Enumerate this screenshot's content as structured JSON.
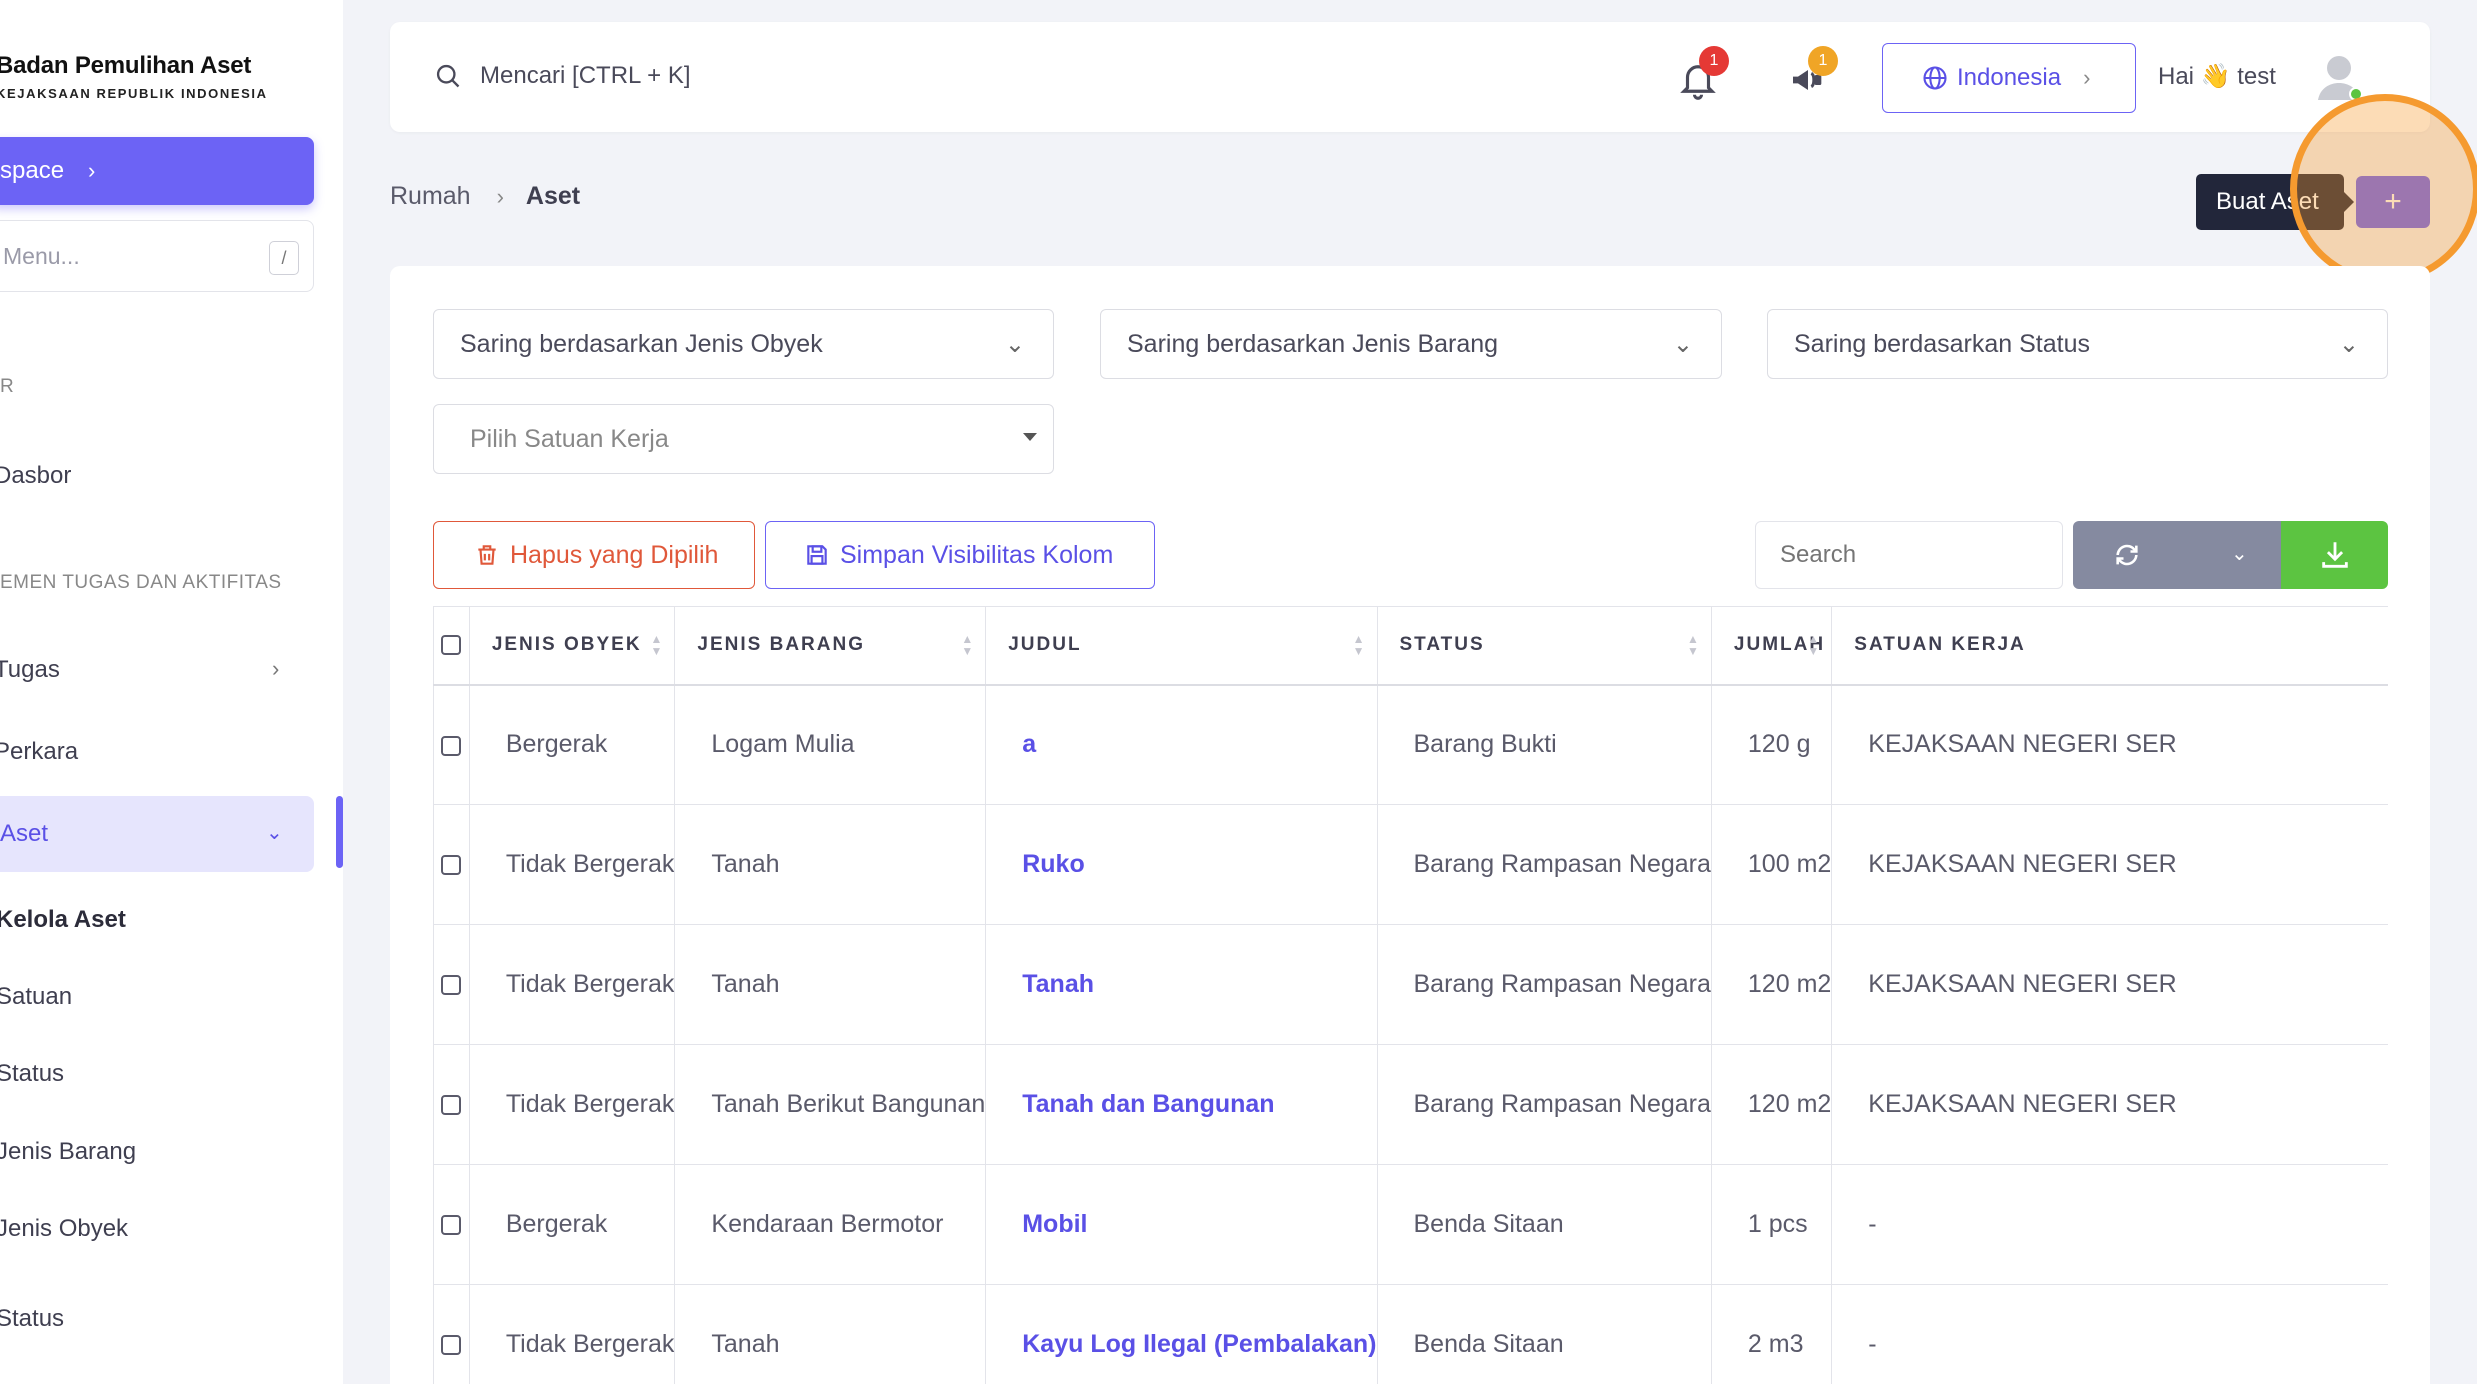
{
  "sidebar": {
    "brand_title": "Badan Pemulihan Aset",
    "brand_subtitle": "KEJAKSAAN REPUBLIK INDONESIA",
    "workspace_label": "space",
    "menu_search_placeholder": "Menu...",
    "menu_search_shortcut": "/",
    "section_1": "R",
    "dashboard": "Dasbor",
    "section_2": "EMEN TUGAS DAN AKTIFITAS",
    "tugas": "Tugas",
    "perkara": "Perkara",
    "aset": "Aset",
    "kelola_aset": "Kelola Aset",
    "satuan": "Satuan",
    "status": "Status",
    "jenis_barang": "Jenis Barang",
    "jenis_obyek": "Jenis Obyek",
    "status_2": "Status"
  },
  "topbar": {
    "search_placeholder": "Mencari [CTRL + K]",
    "notif_count": "1",
    "announce_count": "1",
    "language": "Indonesia",
    "greeting": "Hai 👋 test"
  },
  "breadcrumb": {
    "home": "Rumah",
    "current": "Aset"
  },
  "actions": {
    "tooltip": "Buat Aset",
    "add_symbol": "+"
  },
  "filters": {
    "jenis_obyek": "Saring berdasarkan Jenis Obyek",
    "jenis_barang": "Saring berdasarkan Jenis Barang",
    "status": "Saring berdasarkan Status",
    "satuan_kerja": "Pilih Satuan Kerja"
  },
  "toolbar": {
    "delete_selected": "Hapus yang Dipilih",
    "save_visibility": "Simpan Visibilitas Kolom",
    "search_placeholder": "Search"
  },
  "table": {
    "headers": [
      "JENIS OBYEK",
      "JENIS BARANG",
      "JUDUL",
      "STATUS",
      "JUMLAH",
      "SATUAN KERJA"
    ],
    "rows": [
      [
        "Bergerak",
        "Logam Mulia",
        "a",
        "Barang Bukti",
        "120 g",
        "KEJAKSAAN NEGERI SER"
      ],
      [
        "Tidak Bergerak",
        "Tanah",
        "Ruko",
        "Barang Rampasan Negara",
        "100 m2",
        "KEJAKSAAN NEGERI SER"
      ],
      [
        "Tidak Bergerak",
        "Tanah",
        "Tanah",
        "Barang Rampasan Negara",
        "120 m2",
        "KEJAKSAAN NEGERI SER"
      ],
      [
        "Tidak Bergerak",
        "Tanah Berikut Bangunan",
        "Tanah dan Bangunan",
        "Barang Rampasan Negara",
        "120 m2",
        "KEJAKSAAN NEGERI SER"
      ],
      [
        "Bergerak",
        "Kendaraan Bermotor",
        "Mobil",
        "Benda Sitaan",
        "1 pcs",
        "-"
      ],
      [
        "Tidak Bergerak",
        "Tanah",
        "Kayu Log Ilegal (Pembalakan)",
        "Benda Sitaan",
        "2 m3",
        "-"
      ]
    ]
  },
  "colors": {
    "primary": "#6c63f5",
    "danger": "#e0583a",
    "success": "#5cc441",
    "refresh": "#858aa0",
    "highlight": "#f59a2f"
  }
}
